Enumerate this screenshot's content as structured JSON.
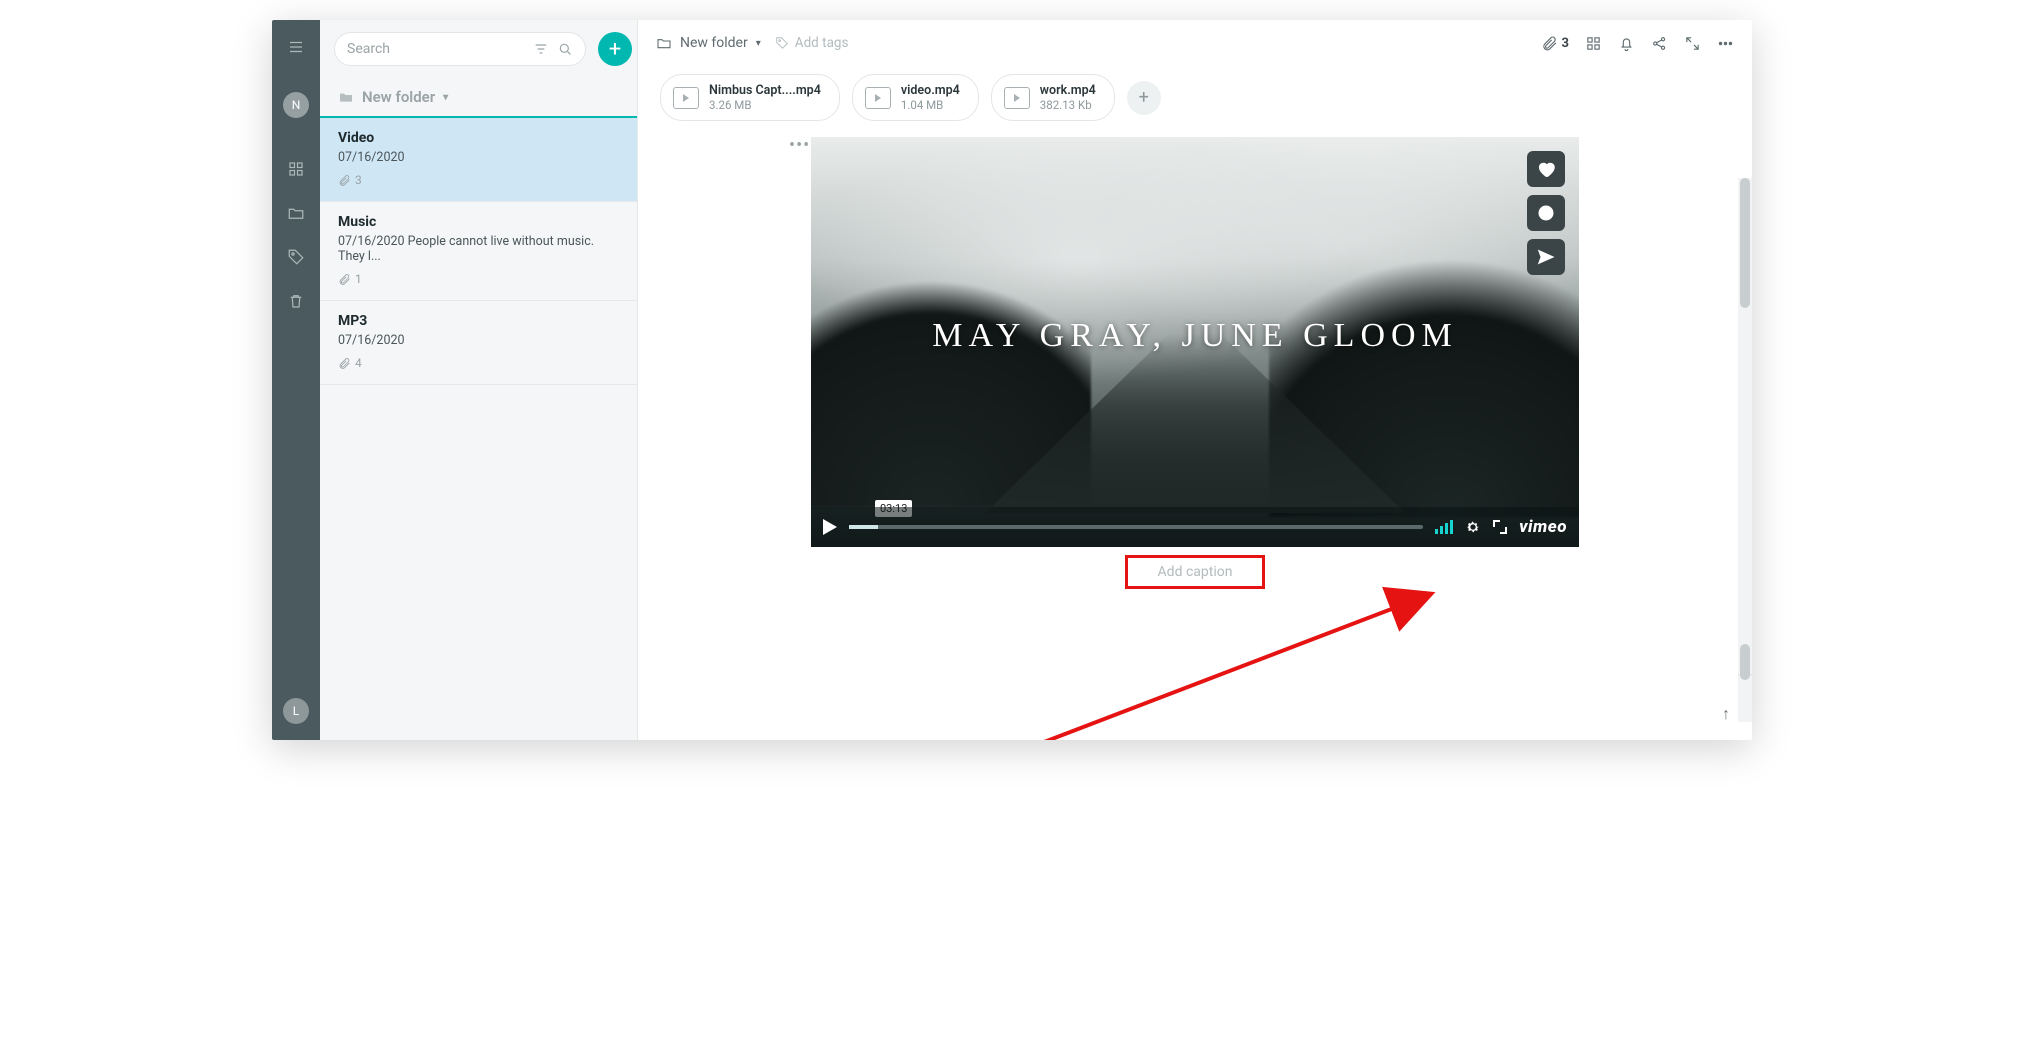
{
  "search": {
    "placeholder": "Search"
  },
  "folder": {
    "name": "New folder"
  },
  "notes": {
    "0": {
      "title": "Video",
      "date": "07/16/2020",
      "snippet": "",
      "att": "3"
    },
    "1": {
      "title": "Music",
      "date": "07/16/2020",
      "snippet": "People cannot live without music. They l...",
      "att": "1"
    },
    "2": {
      "title": "MP3",
      "date": "07/16/2020",
      "snippet": "",
      "att": "4"
    }
  },
  "topbar": {
    "crumb": "New folder",
    "tags_placeholder": "Add tags",
    "att_count": "3"
  },
  "chips": {
    "0": {
      "name": "Nimbus Capt....mp4",
      "size": "3.26 MB"
    },
    "1": {
      "name": "video.mp4",
      "size": "1.04 MB"
    },
    "2": {
      "name": "work.mp4",
      "size": "382.13 Kb"
    }
  },
  "video": {
    "title": "MAY GRAY, JUNE GLOOM",
    "time": "03:13",
    "brand": "vimeo"
  },
  "caption": {
    "placeholder": "Add caption"
  },
  "avatars": {
    "top": "N",
    "bottom": "L"
  }
}
